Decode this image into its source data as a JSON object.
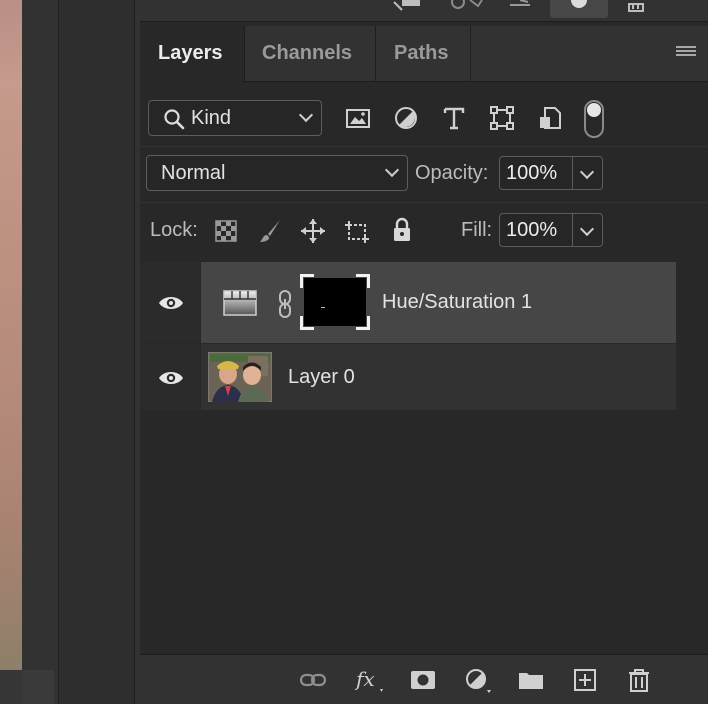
{
  "tabs": [
    "Layers",
    "Channels",
    "Paths"
  ],
  "filter": {
    "kind_label": "Kind"
  },
  "blend": {
    "mode": "Normal",
    "opacity_label": "Opacity:",
    "opacity_value": "100%"
  },
  "lock": {
    "lock_label": "Lock:",
    "fill_label": "Fill:",
    "fill_value": "100%"
  },
  "layers": [
    {
      "name": "Hue/Saturation 1",
      "visible": true,
      "selected": true
    },
    {
      "name": "Layer 0",
      "visible": true,
      "selected": false
    }
  ],
  "colors": {
    "panel_bg": "#282828",
    "selected_row": "#464646",
    "text": "#e3e3e3"
  }
}
